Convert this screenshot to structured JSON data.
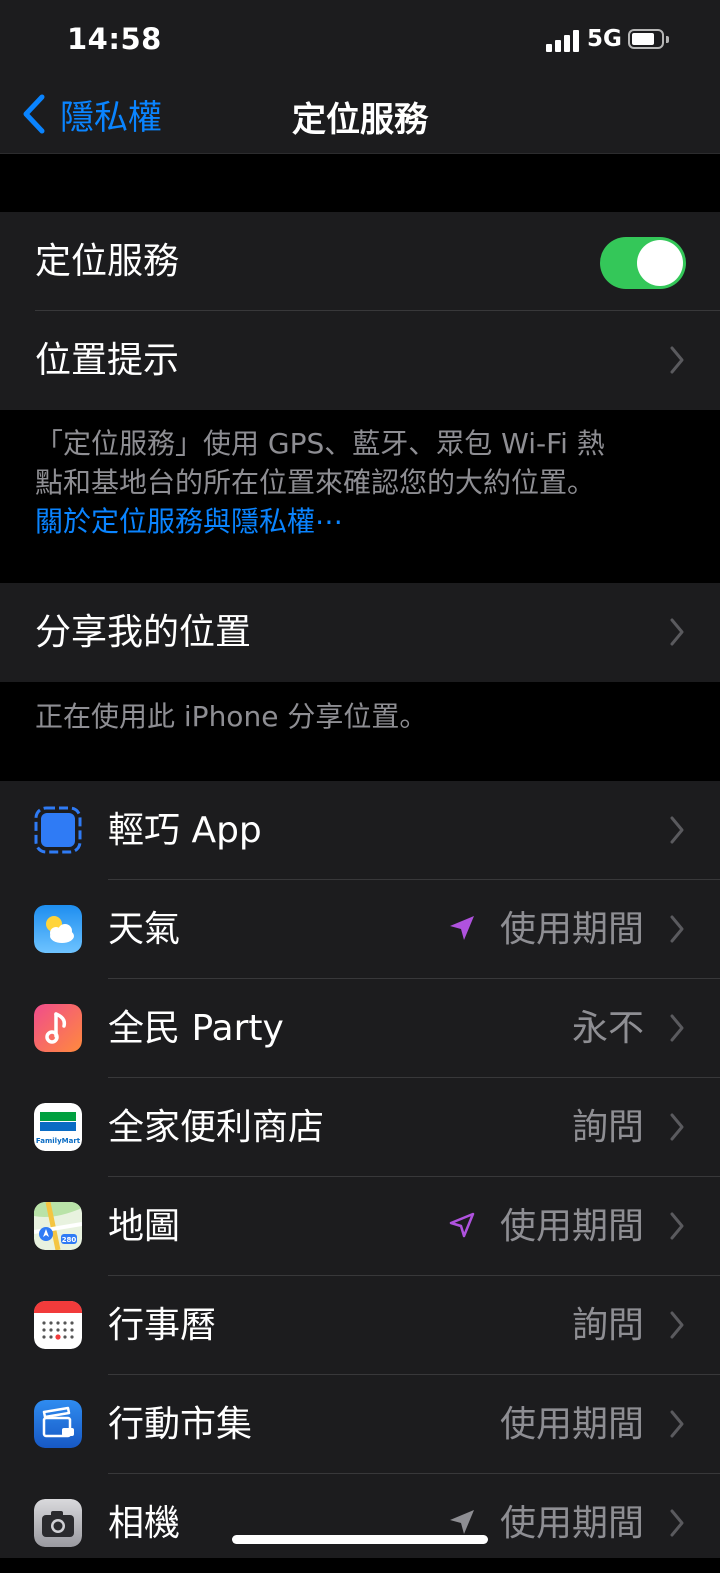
{
  "status_bar": {
    "time": "14:58",
    "network": "5G"
  },
  "nav": {
    "back_label": "隱私權",
    "title": "定位服務"
  },
  "settings": {
    "location_services_label": "定位服務",
    "location_alerts_label": "位置提示"
  },
  "footnote": {
    "line1": "「定位服務」使用 GPS、藍牙、眾包 Wi-Fi 熱",
    "line2": "點和基地台的所在位置來確認您的大約位置。",
    "link": "關於定位服務與隱私權⋯"
  },
  "share": {
    "label": "分享我的位置",
    "footnote": "正在使用此 iPhone 分享位置。"
  },
  "apps": [
    {
      "name": "輕巧 App",
      "value": ""
    },
    {
      "name": "天氣",
      "value": "使用期間"
    },
    {
      "name": "全民 Party",
      "value": "永不"
    },
    {
      "name": "全家便利商店",
      "value": "詢問"
    },
    {
      "name": "地圖",
      "value": "使用期間"
    },
    {
      "name": "行事曆",
      "value": "詢問"
    },
    {
      "name": "行動市集",
      "value": "使用期間"
    },
    {
      "name": "相機",
      "value": "使用期間"
    }
  ],
  "icons": {
    "familymart_text": "FamilyMart",
    "maps_shield": "280"
  },
  "colors": {
    "accent": "#0a84ff",
    "toggle_on": "#34c759",
    "location_arrow": "#af52de"
  }
}
